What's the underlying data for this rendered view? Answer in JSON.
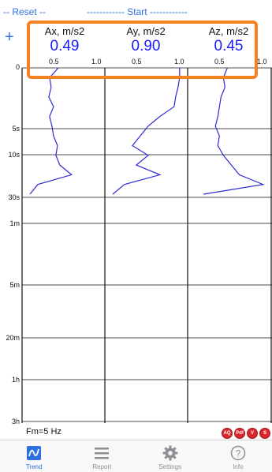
{
  "topbar": {
    "reset_label": "-- Reset --",
    "start_label": "------------ Start ------------",
    "plus_label": "+"
  },
  "columns": [
    {
      "title": "Ax, m/s2",
      "value": "0.49"
    },
    {
      "title": "Ay, m/s2",
      "value": "0.90"
    },
    {
      "title": "Az, m/s2",
      "value": "0.45"
    }
  ],
  "axis": {
    "ticks": [
      "0.5",
      "1.0"
    ],
    "time_labels": [
      "0",
      "5s",
      "10s",
      "30s",
      "1m",
      "5m",
      "20m",
      "1h",
      "3h"
    ]
  },
  "chart_data": {
    "type": "line",
    "y_axis": "time (log scale)",
    "xlim": [
      0,
      1.0
    ],
    "series": [
      {
        "name": "Ax",
        "values_approx": [
          0.46,
          0.35,
          0.37,
          0.34,
          0.4,
          0.35,
          0.38,
          0.4,
          0.45,
          0.43,
          0.48,
          0.63,
          0.2,
          0.1
        ]
      },
      {
        "name": "Ay",
        "values_approx": [
          0.95,
          0.95,
          0.93,
          0.9,
          0.88,
          0.7,
          0.55,
          0.45,
          0.35,
          0.55,
          0.4,
          0.7,
          0.25,
          0.1
        ]
      },
      {
        "name": "Az",
        "values_approx": [
          0.5,
          0.45,
          0.47,
          0.42,
          0.4,
          0.38,
          0.35,
          0.4,
          0.38,
          0.45,
          0.55,
          0.65,
          0.95,
          0.2
        ]
      }
    ],
    "colors": {
      "line": "#2b2bd6",
      "grid": "#111111",
      "accent": "#f58220"
    }
  },
  "footer": {
    "fm_label": "Fm=5 Hz",
    "badges": [
      "AQ",
      "Pdf",
      "V",
      "S"
    ]
  },
  "tabs": [
    {
      "label": "Trend",
      "icon": "trend-icon",
      "active": true
    },
    {
      "label": "Report",
      "icon": "list-icon",
      "active": false
    },
    {
      "label": "Settings",
      "icon": "gear-icon",
      "active": false
    },
    {
      "label": "Info",
      "icon": "question-icon",
      "active": false
    }
  ]
}
